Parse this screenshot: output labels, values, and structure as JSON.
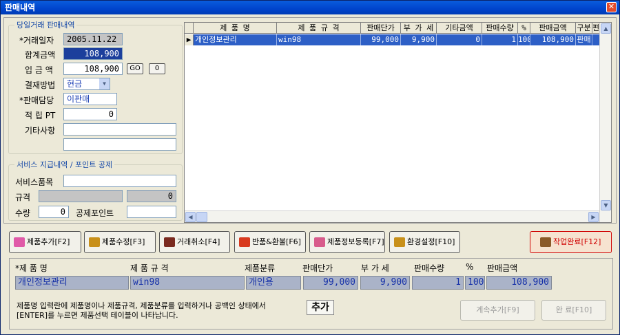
{
  "window": {
    "title": "판매내역",
    "close": "✕"
  },
  "today_sales": {
    "legend": "당일거래 판매내역",
    "date_label": "*거래일자",
    "date_value": "2005.11.22",
    "total_label": "합계금액",
    "total_value": "108,900",
    "paid_label": "입 금 액",
    "paid_value": "108,900",
    "go_label": "GO",
    "zero_label": "0",
    "payment_label": "결재방법",
    "payment_value": "현금",
    "staff_label": "*판매담당",
    "staff_value": "이판매",
    "points_label": "적 립 PT",
    "points_value": "0",
    "etc_label": "기타사항",
    "etc_value1": "",
    "etc_value2": ""
  },
  "service": {
    "legend": "서비스 지급내역 / 포인트 공제",
    "item_label": "서비스품목",
    "item_value": "",
    "spec_label": "규격",
    "spec_value": "",
    "spec_num": "0",
    "qty_label": "수량",
    "qty_value": "0",
    "deduct_label": "공제포인트",
    "deduct_value": ""
  },
  "grid": {
    "columns": [
      "제 품 명",
      "제 품 규 격",
      "판매단가",
      "부 가 세",
      "기타금액",
      "판매수량",
      "%",
      "판매금액",
      "구분",
      "편"
    ],
    "rows": [
      [
        "개인정보관리",
        "win98",
        "99,000",
        "9,900",
        "0",
        "1",
        "100",
        "108,900",
        "판매",
        ""
      ]
    ]
  },
  "buttons": {
    "add": "제품추가[F2]",
    "edit": "제품수정[F3]",
    "cancel": "거래취소[F4]",
    "refund": "반품&환불[F6]",
    "register": "제품정보등록[F7]",
    "settings": "환경설정[F10]",
    "complete": "작업완료[F12]"
  },
  "entry": {
    "headers": {
      "name": "*제 품 명",
      "spec": "제 품 규 격",
      "category": "제품분류",
      "price": "판매단가",
      "vat": "부 가 세",
      "qty": "판매수량",
      "pct": "%",
      "amount": "판매금액"
    },
    "values": {
      "name": "개인정보관리",
      "spec": "win98",
      "category": "개인용",
      "price": "99,000",
      "vat": "9,900",
      "qty": "1",
      "pct": "100",
      "amount": "108,900"
    },
    "note_line1": "제품명 입력란에 제품명이나 제품규격, 제품분류를 입력하거나 공백인 상태에서",
    "note_line2": "[ENTER]를 누르면 제품선택 테이블이 나타납니다.",
    "add_label": "추가",
    "continue_label": "계속추가[F9]",
    "done_label": "완 료[F10]"
  }
}
